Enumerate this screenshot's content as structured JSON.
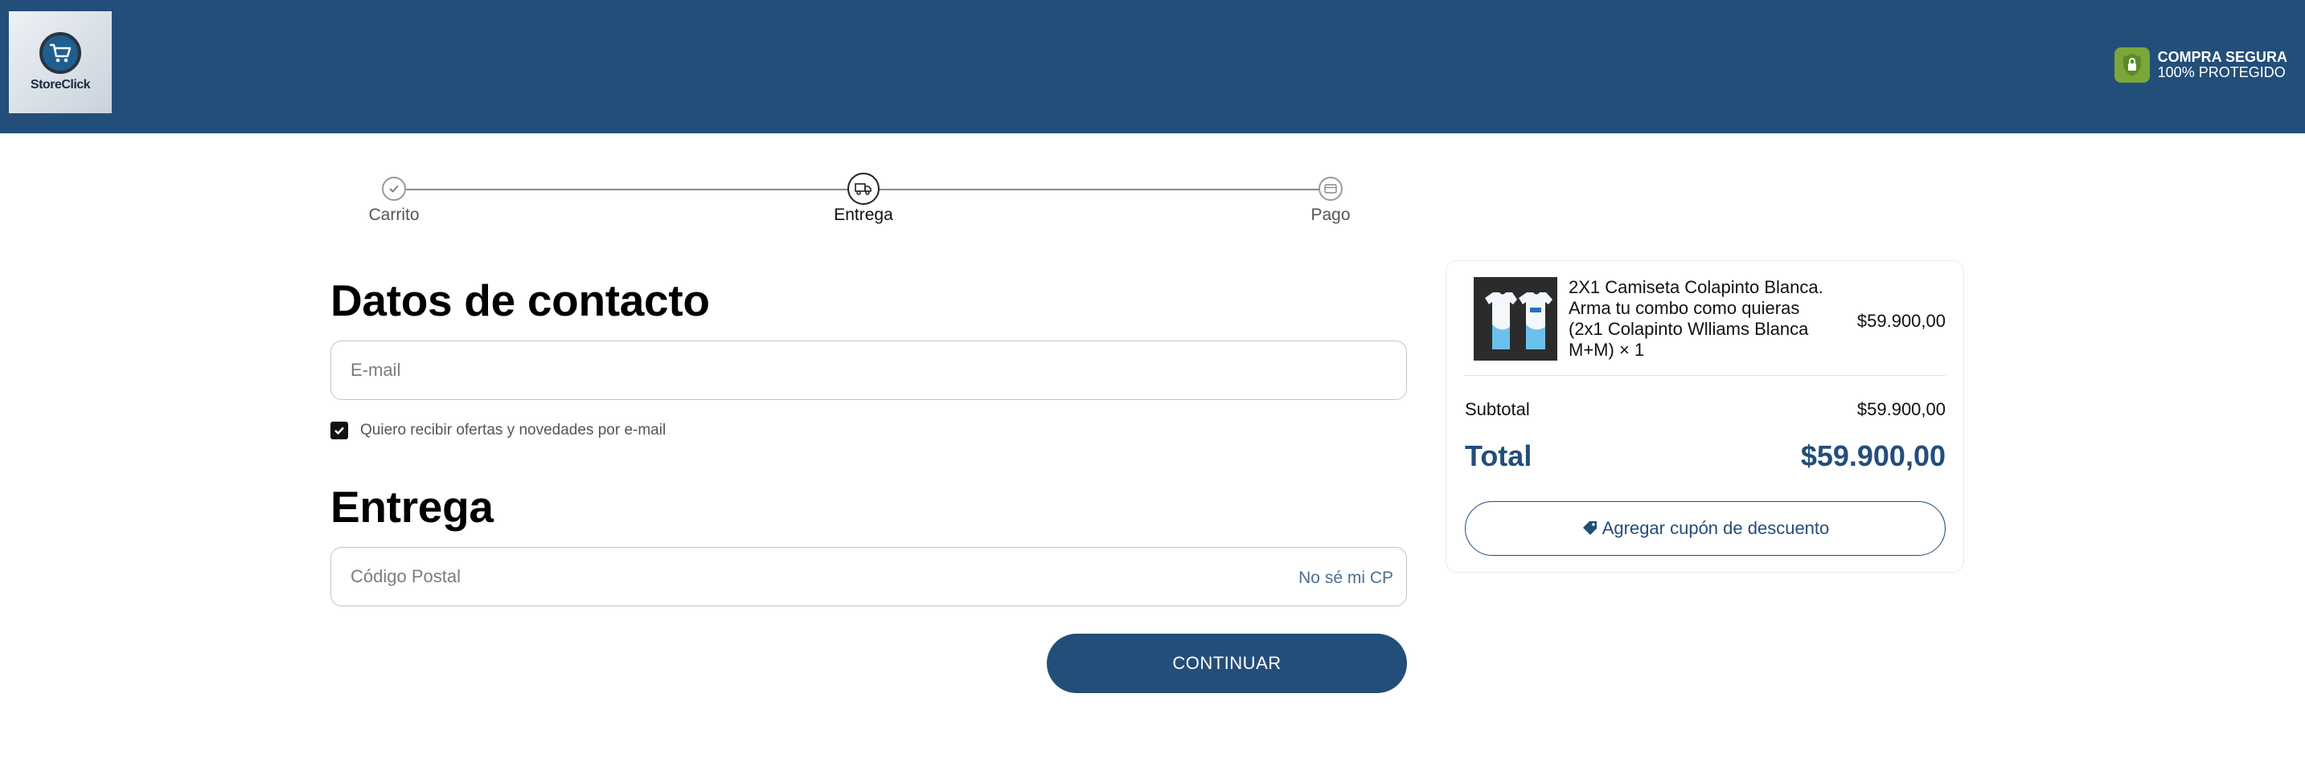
{
  "header": {
    "logo_text": "StoreClick",
    "secure_line1": "COMPRA SEGURA",
    "secure_line2": "100% PROTEGIDO",
    "icons": {
      "logo": "cart-icon",
      "secure": "shield-lock-icon"
    }
  },
  "steps": [
    {
      "label": "Carrito",
      "state": "completed",
      "icon": "check-icon"
    },
    {
      "label": "Entrega",
      "state": "active",
      "icon": "truck-icon"
    },
    {
      "label": "Pago",
      "state": "pending",
      "icon": "card-icon"
    }
  ],
  "contact": {
    "title": "Datos de contacto",
    "email_placeholder": "E-mail",
    "email_value": "",
    "newsletter_label": "Quiero recibir ofertas y novedades por e-mail",
    "newsletter_checked": true
  },
  "delivery": {
    "title": "Entrega",
    "postal_placeholder": "Código Postal",
    "postal_value": "",
    "unknown_cp_link": "No sé mi CP"
  },
  "continue_label": "CONTINUAR",
  "summary": {
    "item_name": "2X1 Camiseta Colapinto Blanca. Arma tu combo como quieras (2x1 Colapinto Wlliams Blanca M+M) × 1",
    "item_price": "$59.900,00",
    "subtotal_label": "Subtotal",
    "subtotal_value": "$59.900,00",
    "total_label": "Total",
    "total_value": "$59.900,00",
    "coupon_label": "Agregar cupón de descuento"
  },
  "colors": {
    "brand": "#234e7a",
    "secure_green": "#7aa63a"
  }
}
